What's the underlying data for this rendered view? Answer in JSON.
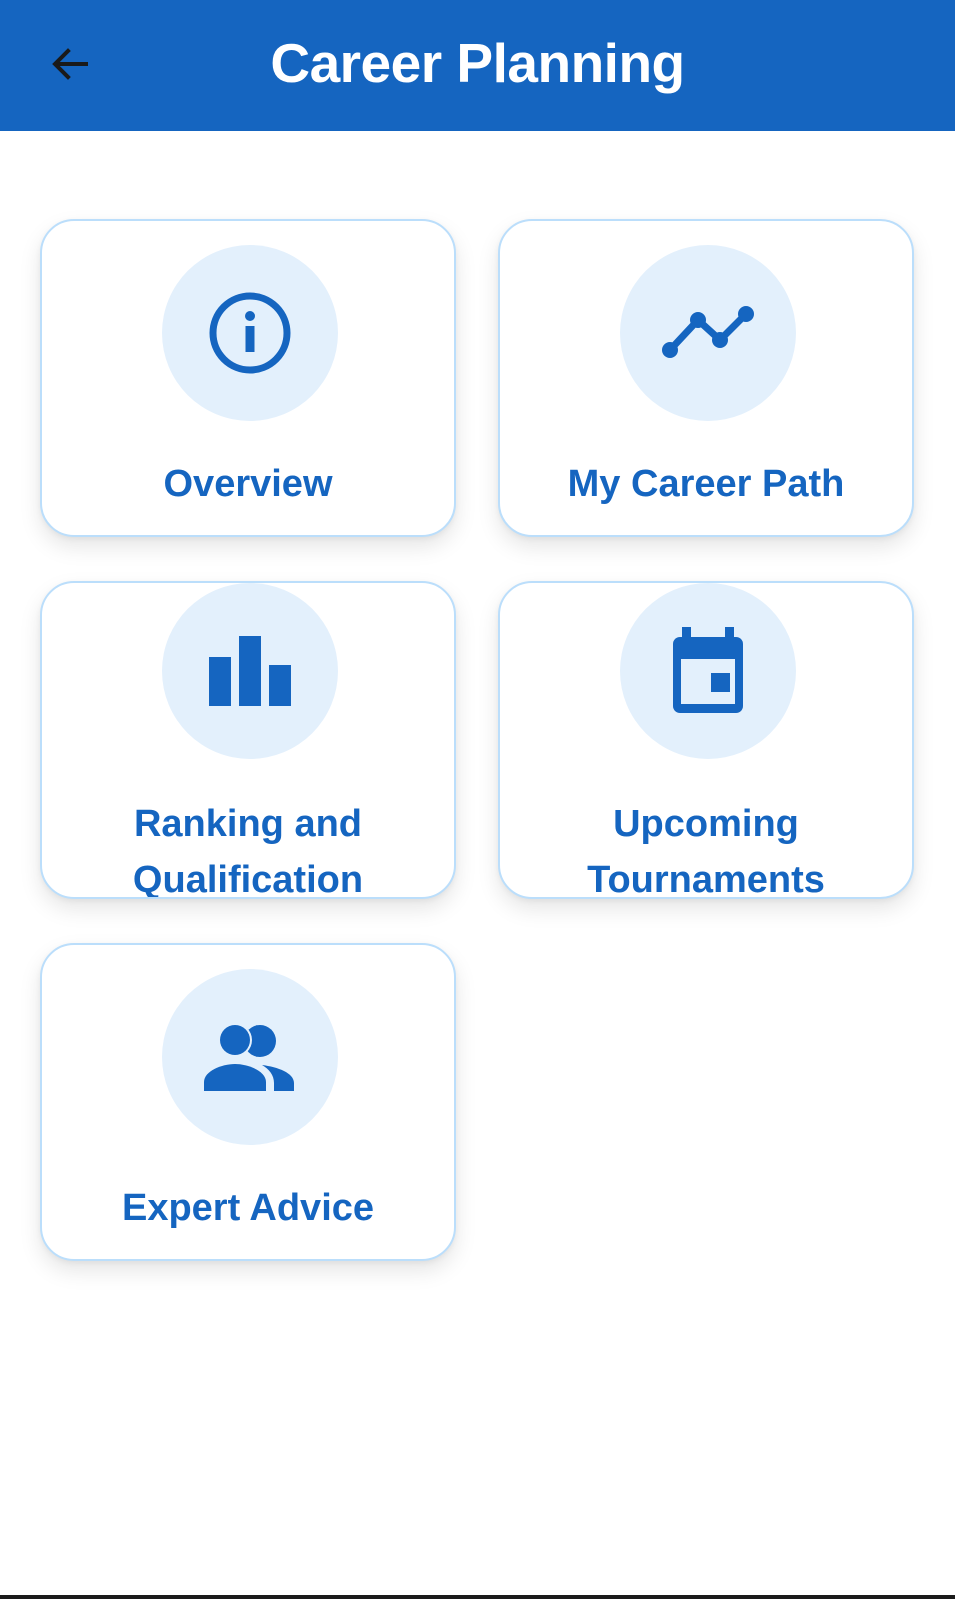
{
  "app_bar": {
    "title": "Career Planning",
    "back_icon": "arrow-back-icon",
    "background_color": "#1565c0"
  },
  "tiles": [
    {
      "label": "Overview",
      "icon": "info-icon"
    },
    {
      "label": "My Career Path",
      "icon": "trending-line-icon"
    },
    {
      "label": "Ranking and Qualification",
      "icon": "bar-chart-icon"
    },
    {
      "label": "Upcoming Tournaments",
      "icon": "calendar-icon"
    },
    {
      "label": "Expert Advice",
      "icon": "people-icon"
    }
  ],
  "colors": {
    "accent": "#1565c0",
    "tile_border": "#bbdefb",
    "icon_circle": "#e3f0fc"
  }
}
